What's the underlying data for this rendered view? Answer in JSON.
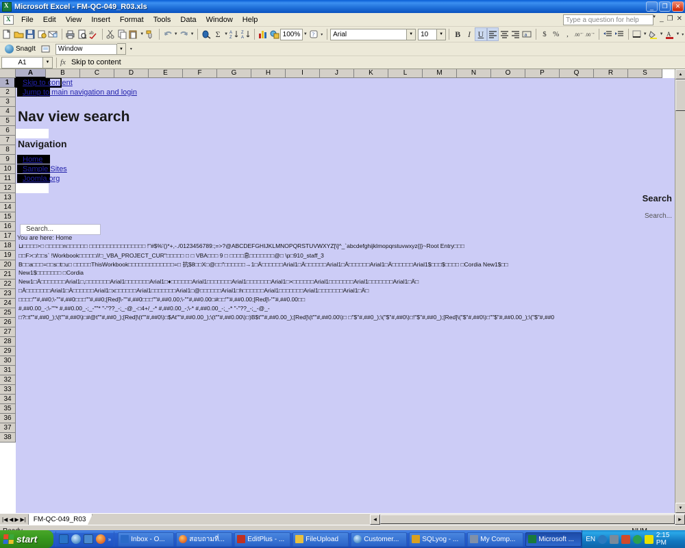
{
  "window": {
    "title": "Microsoft Excel - FM-QC-049_R03.xls",
    "app_icon": "excel-icon",
    "minimize": "_",
    "maximize": "❐",
    "close": "✕"
  },
  "menu": {
    "items": [
      "File",
      "Edit",
      "View",
      "Insert",
      "Format",
      "Tools",
      "Data",
      "Window",
      "Help"
    ],
    "help_placeholder": "Type a question for help",
    "doc_minimize": "_",
    "doc_restore": "❐",
    "doc_close": "✕"
  },
  "standard_toolbar": {
    "zoom_value": "100%",
    "buttons": [
      "new-icon",
      "open-icon",
      "save-icon",
      "permission-icon",
      "email-icon",
      "print-icon",
      "print-preview-icon",
      "spelling-icon",
      "cut-icon",
      "copy-icon",
      "paste-icon",
      "format-painter-icon",
      "undo-icon",
      "redo-icon",
      "hyperlink-icon",
      "autosum-icon",
      "sort-asc-icon",
      "sort-desc-icon",
      "chart-wizard-icon",
      "drawing-icon",
      "help-icon"
    ]
  },
  "snagit_toolbar": {
    "label": "SnagIt",
    "profile_icon": "snagit-profile-icon",
    "mode_value": "Window"
  },
  "formatting_toolbar": {
    "font_name": "Arial",
    "font_size": "10",
    "bold": "B",
    "italic": "I",
    "underline": "U",
    "align_left": "align-left-icon",
    "align_center": "align-center-icon",
    "align_right": "align-right-icon",
    "merge_center": "merge-center-icon",
    "currency": "$",
    "percent": "%",
    "comma": ",",
    "increase_decimal": "increase-decimal-icon",
    "decrease_decimal": "decrease-decimal-icon",
    "decrease_indent": "decrease-indent-icon",
    "increase_indent": "increase-indent-icon",
    "borders": "borders-icon",
    "fill_color": "fill-color-icon",
    "font_color": "font-color-icon"
  },
  "formula_bar": {
    "name_box": "A1",
    "fx_label": "fx",
    "formula_value": "Skip to content"
  },
  "grid": {
    "columns": [
      "A",
      "B",
      "C",
      "D",
      "E",
      "F",
      "G",
      "H",
      "I",
      "J",
      "K",
      "L",
      "M",
      "N",
      "O",
      "P",
      "Q",
      "R",
      "S"
    ],
    "selected_column": "A",
    "selected_row": "1",
    "rows": [
      "1",
      "2",
      "3",
      "4",
      "5",
      "6",
      "7",
      "8",
      "9",
      "10",
      "11",
      "12",
      "13",
      "14",
      "15",
      "16",
      "17",
      "18",
      "19",
      "20",
      "21",
      "22",
      "23",
      "24",
      "25",
      "26",
      "27",
      "28",
      "29",
      "30",
      "31",
      "32",
      "33",
      "34",
      "35",
      "36",
      "37",
      "38"
    ],
    "content": {
      "r1_link": "Skip to content",
      "r2_link": "Jump to main navigation and login",
      "r4_heading": "Nav view search",
      "r6_heading": "Navigation",
      "r8_link": "Home",
      "r9_link": "Sample Sites",
      "r10_link": "Joomla.org",
      "r12_search_heading": "Search",
      "r14_search_label": "Search...",
      "r15_search_input": "Search...",
      "r16_breadcrumb": "You are here: Home",
      "bin_line_1": "⊔□□□□>□ □□□□□n□□□□□□ □□□□□□□□□□□□□□□□ !\"#$%'()*+,-./0123456789:;=>?@ABCDEFGHIJKLMNOPQRSTUVWXYZ[\\]^_`abcdefghijklmopqrstuvwxyz{|}~Root Entry□□□",
      "bin_line_2": "□□F>□/□□s` !Workbook□□□□□//□_VBA_PROJECT_CUR\"□□□□□ □ □  VBA□□□ 9 □ □□□□息□□□□□□□@□  \\p□910_staff_3",
      "bin_line_3": "B□□a□□□=□□s□t□u□ □□□□□ThisWorkbook□□□□□□□□□□□□□=□ 抗$8□□X□@□□\"□□□□□□→1□Ä□□□□□□Arial1□Ä□□□□□□Arial1□Ä□□□□□□Arial1□Ä□□□□□□Arial1$□□□$□□□□ □Cordia New1$□□",
      "bin_line_4": "New1$□□□□□□□ □Cordia",
      "bin_line_5": "New1□Ä□□□□□□□Arial1□,□□□□□□□Arial1□□□□□□□Arial1□♦□□□□□□Arial1□□□□□□□Arial1□□□□□□□Arial1□×□□□□□□Arial1□□□□□□□Arial1□□□□□□□Arial1□Ä□",
      "bin_line_6": "□Ä□□□□□□□Arial1□À□□□□□□Arial1□x□□□□□□Arial1□□□□□□□Arial1□@□□□□□□Arial1□h□□□□□□Arial1□□□□□□□Arial1□□□□□□□Arial1□Ä□",
      "bin_line_7": "□□□□\"\"#,##0;\\-\"\"#,##0□□□\"\"#,##0;[Red]\\-\"\"#,##0□□□\"\"#,##0.00;\\-\"\"#,##0.00□#□□\"\"#,##0.00;[Red]\\-\"\"#,##0.00□□",
      "bin_line_8": "#,##0.00_-;\\-\"\"* #,##0.00_-;_-\"\"* \"-\"??_-;_-@_-□4+/_-* #,##0.00_-;\\-* #,##0.00_-;_-* \"-\"??_-;_-@_-",
      "bin_line_9": "□?□t\"\"#,##0_);\\(t\"\"#,##0\\)□#@t\"\"#,##0_);[Red]\\(t\"\"#,##0\\)□$At\"\"#,##0.00_);\\(t\"\"#,##0.00\\)□)B$t\"\"#,##0.00_);[Red]\\(t\"\"#,##0.00\\)□ □\"$\"#,##0_);\\(\"$\"#,##0\\)□!\"$\"#,##0_);[Red]\\(\"$\"#,##0\\)□\"\"$\"#,##0.00_);\\(\"$\"#,##0"
    }
  },
  "sheet_tabs": {
    "first": "first-sheet-icon",
    "prev": "prev-sheet-icon",
    "next": "next-sheet-icon",
    "last": "last-sheet-icon",
    "tabs": [
      "FM-QC-049_R03"
    ],
    "active": "FM-QC-049_R03"
  },
  "status_bar": {
    "message": "Ready",
    "num_lock": "NUM"
  },
  "taskbar": {
    "start_label": "start",
    "quick_launch": [
      "show-desktop-icon",
      "ie-icon",
      "media-icon",
      "firefox-icon"
    ],
    "overflow": "»",
    "items": [
      {
        "label": "Inbox - O...",
        "icon": "outlook-icon",
        "active": false
      },
      {
        "label": "สอบถามที่...",
        "icon": "firefox-icon",
        "active": false
      },
      {
        "label": "EditPlus - ...",
        "icon": "editplus-icon",
        "active": false
      },
      {
        "label": "FileUpload",
        "icon": "folder-icon",
        "active": false
      },
      {
        "label": "Customer...",
        "icon": "ie-icon",
        "active": false
      },
      {
        "label": "SQLyog - ...",
        "icon": "sqlyog-icon",
        "active": false
      },
      {
        "label": "My Comp...",
        "icon": "mycomputer-icon",
        "active": false
      },
      {
        "label": "Microsoft ...",
        "icon": "excel-icon",
        "active": true
      }
    ],
    "tray": {
      "language": "EN",
      "icons": [
        "chevron-left-icon",
        "network-icon",
        "security-icon",
        "messenger-icon",
        "volume-icon"
      ],
      "clock": "2:15 PM"
    }
  },
  "colors": {
    "titlebar_blue": "#1f6fd8",
    "grid_fill": "#ccccf6",
    "chrome": "#ece9d8",
    "link": "#2222aa"
  }
}
